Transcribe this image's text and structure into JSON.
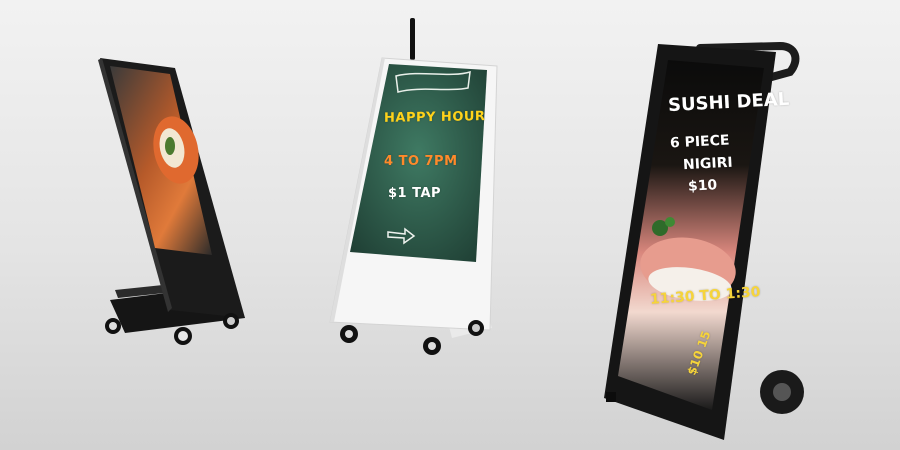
{
  "scene": {
    "background": "#e8e8e8",
    "description_tags": [
      "kiosk-1-black-portrait-sign",
      "kiosk-2-white-portrait-sign",
      "kiosk-3-black-trolley-sign"
    ]
  },
  "kiosk_1": {
    "frame_color": "#1a1a1a",
    "screen_content": "sushi-roll-photo"
  },
  "kiosk_2": {
    "frame_color": "#f4f4f4",
    "board_color": "#2f5f4f",
    "line1": "HAPPY HOUR",
    "line2": "4 TO 7PM",
    "line3": "$1 TAP",
    "accent_colors": [
      "#ffd21a",
      "#ff8a2a",
      "#ffffff"
    ]
  },
  "kiosk_3": {
    "frame_color": "#111111",
    "line1": "SUSHI DEAL",
    "line2": "6 PIECE",
    "line3": "NIGIRI",
    "line4": "$10",
    "line5": "11:30 TO 1:30",
    "line6": "$10 15"
  }
}
